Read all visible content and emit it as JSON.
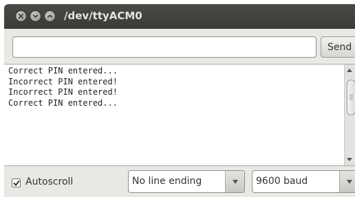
{
  "window": {
    "title": "/dev/ttyACM0",
    "buttons": {
      "close": "close-icon",
      "minimize": "minimize-icon",
      "maximize": "maximize-icon"
    }
  },
  "input": {
    "value": "",
    "placeholder": ""
  },
  "toolbar": {
    "send_label": "Send"
  },
  "console": {
    "lines": [
      "Correct PIN entered...",
      "Incorrect PIN entered!",
      "Incorrect PIN entered!",
      "Correct PIN entered..."
    ]
  },
  "footer": {
    "autoscroll_label": "Autoscroll",
    "autoscroll_checked": true,
    "line_ending": "No line ending",
    "baud_rate": "9600 baud"
  }
}
